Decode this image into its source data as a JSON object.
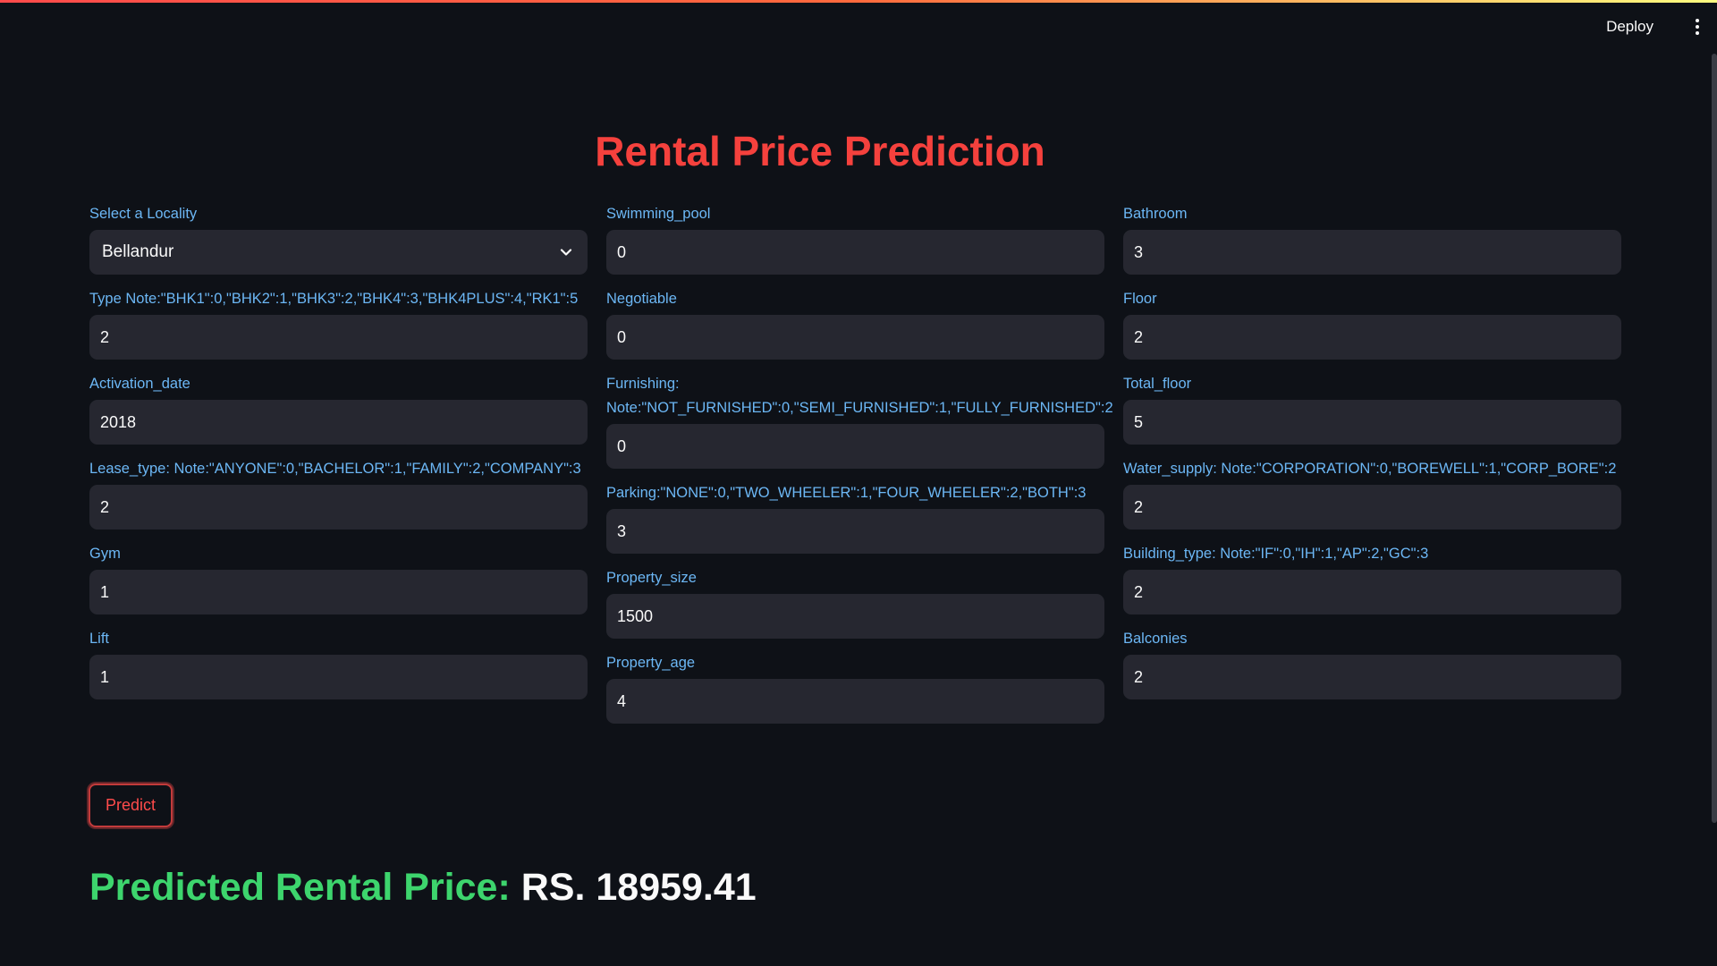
{
  "header": {
    "deploy_label": "Deploy",
    "menu_icon": "more-vertical-icon"
  },
  "colors": {
    "background": "#0e1117",
    "title": "#f5413d",
    "label": "#6cb7f5",
    "input_bg": "#262730",
    "result_label": "#3dd56d",
    "predict_border": "#c23b3b"
  },
  "main": {
    "title": "Rental Price Prediction",
    "columns": [
      {
        "fields": [
          {
            "label": "Select a Locality",
            "value": "Bellandur",
            "type": "select"
          },
          {
            "label": "Type Note:\"BHK1\":0,\"BHK2\":1,\"BHK3\":2,\"BHK4\":3,\"BHK4PLUS\":4,\"RK1\":5",
            "value": "2"
          },
          {
            "label": "Activation_date",
            "value": "2018"
          },
          {
            "label": "Lease_type: Note:\"ANYONE\":0,\"BACHELOR\":1,\"FAMILY\":2,\"COMPANY\":3",
            "value": "2"
          },
          {
            "label": "Gym",
            "value": "1"
          },
          {
            "label": "Lift",
            "value": "1"
          }
        ]
      },
      {
        "fields": [
          {
            "label": "Swimming_pool",
            "value": "0"
          },
          {
            "label": "Negotiable",
            "value": "0"
          },
          {
            "label": "Furnishing:\nNote:\"NOT_FURNISHED\":0,\"SEMI_FURNISHED\":1,\"FULLY_FURNISHED\":2",
            "value": "0"
          },
          {
            "label": "Parking:\"NONE\":0,\"TWO_WHEELER\":1,\"FOUR_WHEELER\":2,\"BOTH\":3",
            "value": "3"
          },
          {
            "label": "Property_size",
            "value": "1500"
          },
          {
            "label": "Property_age",
            "value": "4"
          }
        ]
      },
      {
        "fields": [
          {
            "label": "Bathroom",
            "value": "3"
          },
          {
            "label": "Floor",
            "value": "2"
          },
          {
            "label": "Total_floor",
            "value": "5"
          },
          {
            "label": "Water_supply: Note:\"CORPORATION\":0,\"BOREWELL\":1,\"CORP_BORE\":2",
            "value": "2"
          },
          {
            "label": "Building_type: Note:\"IF\":0,\"IH\":1,\"AP\":2,\"GC\":3",
            "value": "2"
          },
          {
            "label": "Balconies",
            "value": "2"
          }
        ]
      }
    ],
    "predict_label": "Predict",
    "result_label": "Predicted Rental Price:",
    "result_value": "RS. 18959.41"
  }
}
